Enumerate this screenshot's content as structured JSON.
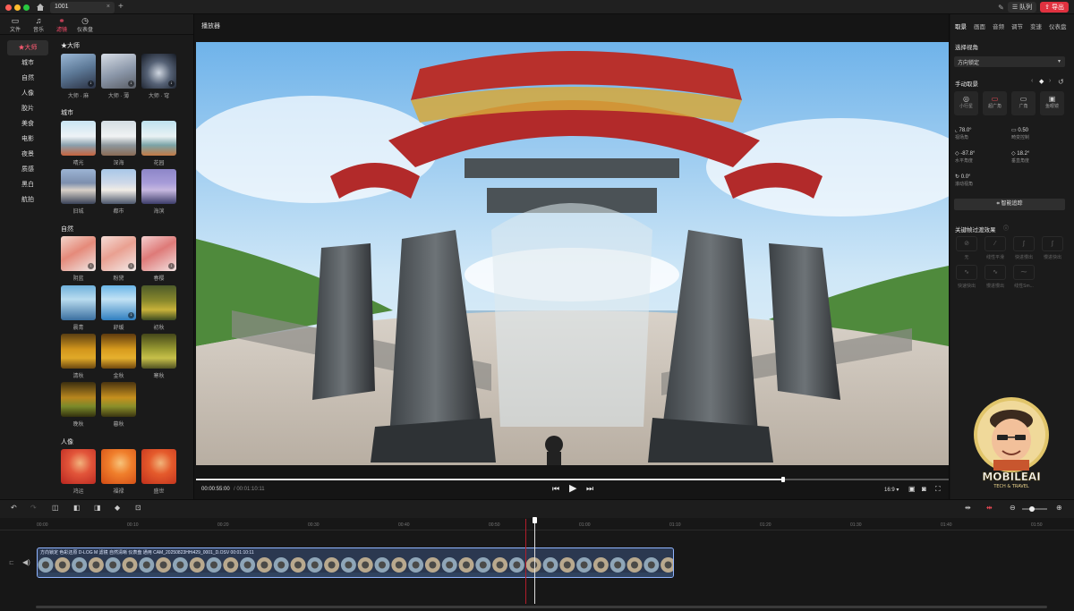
{
  "window": {
    "tab_title": "1001",
    "queue_label": "队列",
    "export_label": "导出"
  },
  "toolbar": {
    "tools": [
      {
        "label": "文件",
        "icon": "folder-icon"
      },
      {
        "label": "音乐",
        "icon": "music-note-icon"
      },
      {
        "label": "滤镜",
        "icon": "filter-icon"
      },
      {
        "label": "仪表盘",
        "icon": "dashboard-icon"
      }
    ],
    "active_tool": "滤镜"
  },
  "categories": [
    "★大师",
    "城市",
    "自然",
    "人像",
    "胶片",
    "美食",
    "电影",
    "夜景",
    "质感",
    "黑白",
    "航拍"
  ],
  "filters": {
    "sections": [
      {
        "title": "★大师",
        "items": [
          "大师 · 麻",
          "大师 · 薄",
          "大师 · 穹"
        ]
      },
      {
        "title": "城市",
        "items": [
          "晴光",
          "深海",
          "花园",
          "旧城",
          "都市",
          "海滨"
        ]
      },
      {
        "title": "自然",
        "items": [
          "阴蓝",
          "粉黛",
          "春樱",
          "晨青",
          "舒缓",
          "初秋",
          "清秋",
          "金秋",
          "寒秋",
          "晚秋",
          "暮秋"
        ]
      },
      {
        "title": "人像",
        "items": [
          "鸿运",
          "福禄",
          "盛世"
        ]
      }
    ]
  },
  "player": {
    "title": "播放器",
    "current_time": "00:00:55:00",
    "total_time": "/ 00:01:10:11",
    "progress_fraction": 0.78,
    "aspect_ratio": "16:9 ▾"
  },
  "right_panel": {
    "tabs": [
      "取景",
      "画面",
      "音频",
      "调节",
      "变速",
      "仪表盘"
    ],
    "active_tab": "取景",
    "choose_view_label": "选择视角",
    "lock_option": "方向锁定",
    "manual_label": "手动取景",
    "views": [
      "小行星",
      "超广角",
      "广角",
      "鱼眼镜"
    ],
    "selected_view": "超广角",
    "params": [
      {
        "value": "78.0°",
        "label": "视场角"
      },
      {
        "value": "0.50",
        "label": "畸变控制"
      },
      {
        "value": "-87.8°",
        "label": "水平角度"
      },
      {
        "value": "18.2°",
        "label": "垂直角度"
      },
      {
        "value": "0.0°",
        "label": "滚动视角"
      }
    ],
    "smart_track_label": "智能追踪",
    "keyframe_label": "关键帧过渡效果",
    "ease_options": [
      "无",
      "线性平滑",
      "快进慢出",
      "慢进快出",
      "快速快出",
      "慢进慢出",
      "线性Sm..."
    ]
  },
  "timeline": {
    "ticks": [
      "00:00",
      "00:10",
      "00:20",
      "00:30",
      "00:40",
      "00:50",
      "01:00",
      "01:10",
      "01:20",
      "01:30",
      "01:40",
      "01:50"
    ],
    "clip_label": "方向锁定   色彩还原 D-LOG M   滤镜 自然清晰   仪表盘 通用   CAM_20250823HHi429_0001_D.OSV   00:01:10:11"
  },
  "watermark": {
    "brand": "MOBILEAI",
    "tagline": "TECH & TRAVEL"
  },
  "colors": {
    "accent_red": "#ff4d5a",
    "clip_border": "#8fb4ff"
  }
}
